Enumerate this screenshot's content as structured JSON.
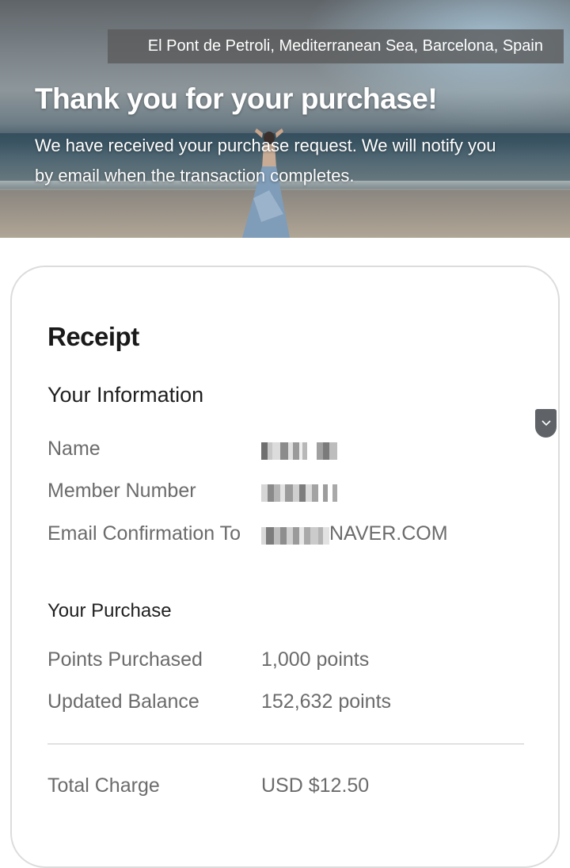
{
  "hero": {
    "location": "El Pont de Petroli, Mediterranean Sea, Barcelona, Spain",
    "title": "Thank you for your purchase!",
    "message": "We have received your purchase request. We will notify you by email when the transaction completes."
  },
  "receipt": {
    "title": "Receipt",
    "your_information": {
      "heading": "Your Information",
      "name_label": "Name",
      "member_number_label": "Member Number",
      "email_label": "Email Confirmation To",
      "email_value_suffix": "NAVER.COM"
    },
    "your_purchase": {
      "heading": "Your Purchase",
      "points_purchased_label": "Points Purchased",
      "points_purchased_value": "1,000 points",
      "updated_balance_label": "Updated Balance",
      "updated_balance_value": "152,632 points"
    },
    "total": {
      "label": "Total Charge",
      "value": "USD $12.50"
    }
  },
  "icons": {
    "collapse": "chevron-down-icon"
  },
  "colors": {
    "text_primary": "#1a1a1a",
    "text_secondary": "#6b6b6b",
    "card_border": "#dcdcdc",
    "location_bg": "#5a5a5a"
  }
}
